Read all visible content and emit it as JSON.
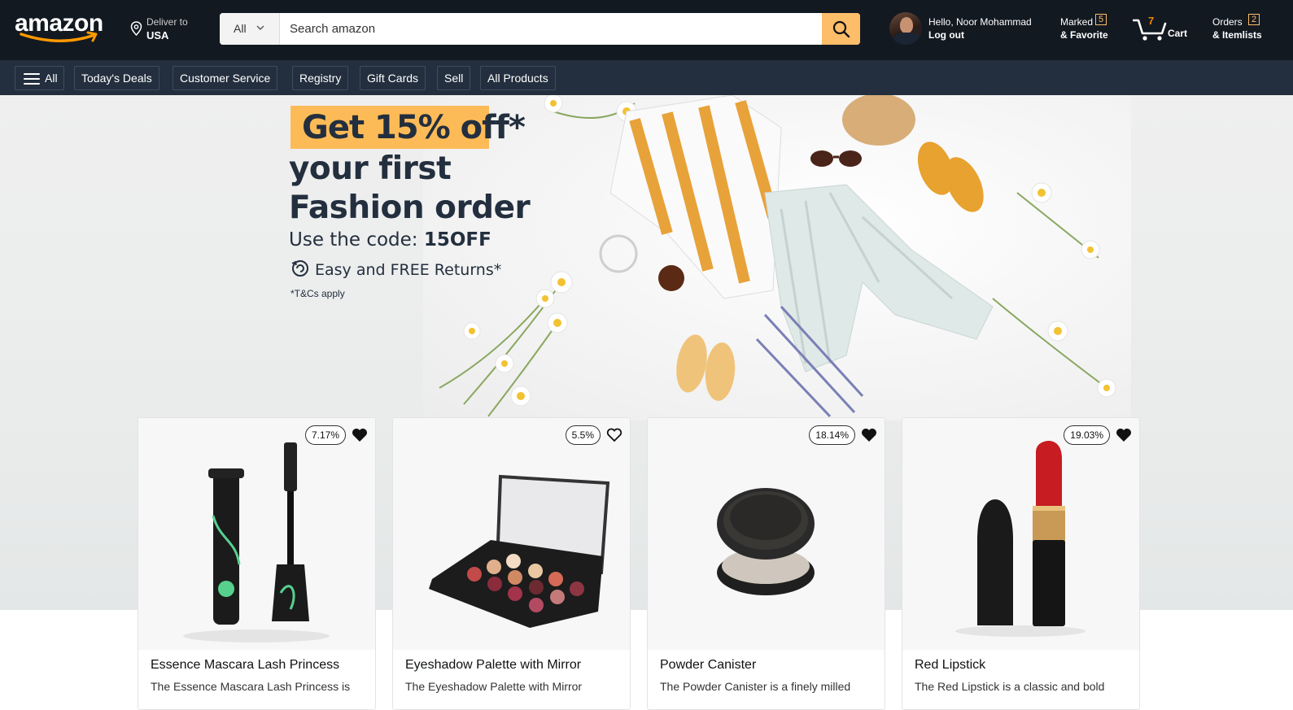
{
  "header": {
    "logo_text": "amazon",
    "deliver_label": "Deliver to",
    "deliver_location": "USA",
    "search": {
      "category": "All",
      "placeholder": "Search amazon"
    },
    "user": {
      "greeting": "Hello, Noor Mohammad",
      "action": "Log out"
    },
    "marked": {
      "label": "Marked",
      "count": "5",
      "sublabel": "& Favorite"
    },
    "cart": {
      "count": "7",
      "label": "Cart"
    },
    "orders": {
      "label": "Orders",
      "count": "2",
      "sublabel": "& Itemlists"
    }
  },
  "nav": {
    "items": [
      "All",
      "Today's Deals",
      "Customer Service",
      "Registry",
      "Gift Cards",
      "Sell",
      "All Products"
    ]
  },
  "hero": {
    "promo_highlight": "Get 15% off*",
    "line1": "your first",
    "line2": "Fashion order",
    "code_prefix": "Use the code: ",
    "code": "15OFF",
    "returns": "Easy and FREE Returns*",
    "terms": "*T&Cs apply"
  },
  "products": [
    {
      "discount": "7.17%",
      "title": "Essence Mascara Lash Princess",
      "desc": "The Essence Mascara Lash Princess is"
    },
    {
      "discount": "5.5%",
      "title": "Eyeshadow Palette with Mirror",
      "desc": "The Eyeshadow Palette with Mirror"
    },
    {
      "discount": "18.14%",
      "title": "Powder Canister",
      "desc": "The Powder Canister is a finely milled"
    },
    {
      "discount": "19.03%",
      "title": "Red Lipstick",
      "desc": "The Red Lipstick is a classic and bold"
    }
  ],
  "colors": {
    "header_bg": "#131921",
    "nav_bg": "#232f3e",
    "accent": "#febd69",
    "promo_box": "#fdbb58"
  }
}
